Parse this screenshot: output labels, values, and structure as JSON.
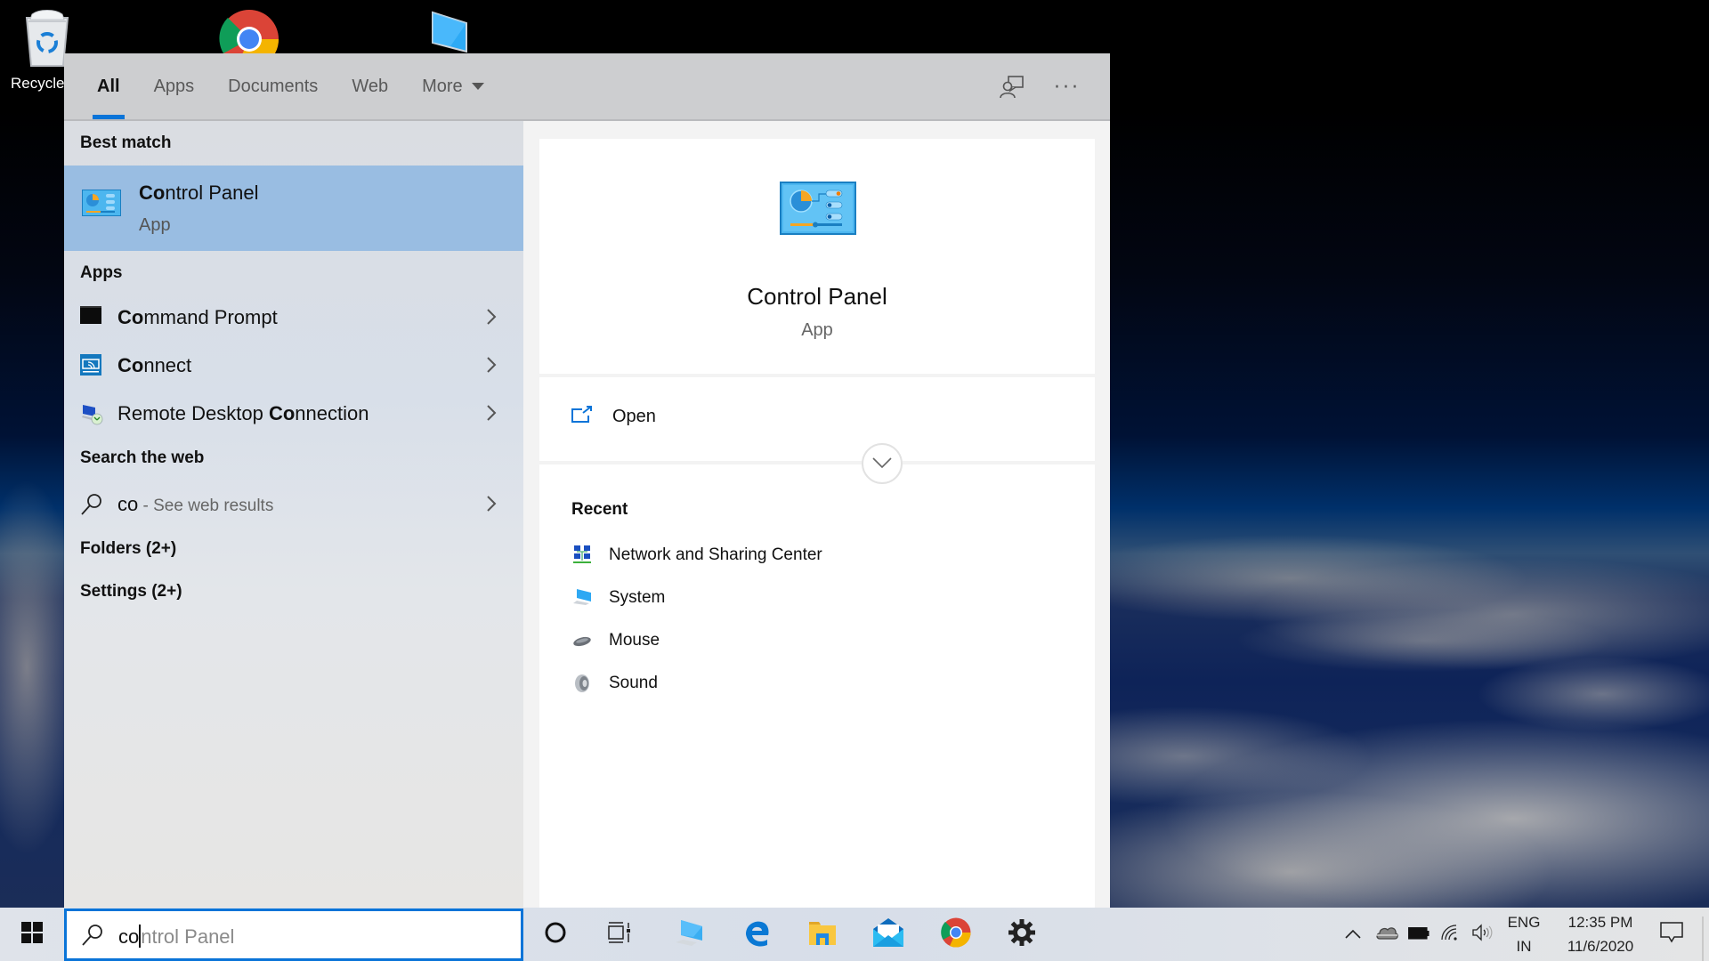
{
  "desktop": {
    "icons": [
      {
        "name": "recycle-bin",
        "label": "Recycle"
      },
      {
        "name": "google-chrome",
        "label": ""
      },
      {
        "name": "this-pc",
        "label": ""
      }
    ]
  },
  "search_panel": {
    "tabs": [
      {
        "label": "All",
        "active": true
      },
      {
        "label": "Apps",
        "active": false
      },
      {
        "label": "Documents",
        "active": false
      },
      {
        "label": "Web",
        "active": false
      },
      {
        "label": "More",
        "active": false,
        "has_dropdown": true
      }
    ],
    "header_actions": {
      "feedback_icon": "feedback-icon",
      "more_options": "···"
    },
    "results": {
      "best_match_heading": "Best match",
      "best_match": {
        "title_bold": "Co",
        "title_rest": "ntrol Panel",
        "subtitle": "App"
      },
      "apps_heading": "Apps",
      "apps": [
        {
          "pre": "",
          "bold": "Co",
          "post": "mmand Prompt",
          "icon": "command-prompt-icon"
        },
        {
          "pre": "",
          "bold": "Co",
          "post": "nnect",
          "icon": "connect-icon"
        },
        {
          "pre": "Remote Desktop ",
          "bold": "Co",
          "post": "nnection",
          "icon": "remote-desktop-icon"
        }
      ],
      "web_heading": "Search the web",
      "web_item": {
        "query": "co",
        "suffix": " - See web results"
      },
      "folders": "Folders (2+)",
      "settings": "Settings (2+)"
    },
    "details": {
      "title": "Control Panel",
      "subtitle": "App",
      "open_label": "Open",
      "recent_heading": "Recent",
      "recent": [
        {
          "label": "Network and Sharing Center",
          "icon": "network-icon"
        },
        {
          "label": "System",
          "icon": "system-icon"
        },
        {
          "label": "Mouse",
          "icon": "mouse-icon"
        },
        {
          "label": "Sound",
          "icon": "sound-icon"
        }
      ]
    }
  },
  "taskbar": {
    "search": {
      "typed": "co",
      "suggestion": "ntrol Panel"
    },
    "pinned": [
      "cortana",
      "task-view",
      "this-pc",
      "edge",
      "file-explorer",
      "mail",
      "chrome",
      "settings"
    ],
    "tray": {
      "lang_top": "ENG",
      "lang_bottom": "IN",
      "time": "12:35 PM",
      "date": "11/6/2020"
    }
  },
  "colors": {
    "accent": "#0a74d8",
    "selection": "#99bde2"
  }
}
